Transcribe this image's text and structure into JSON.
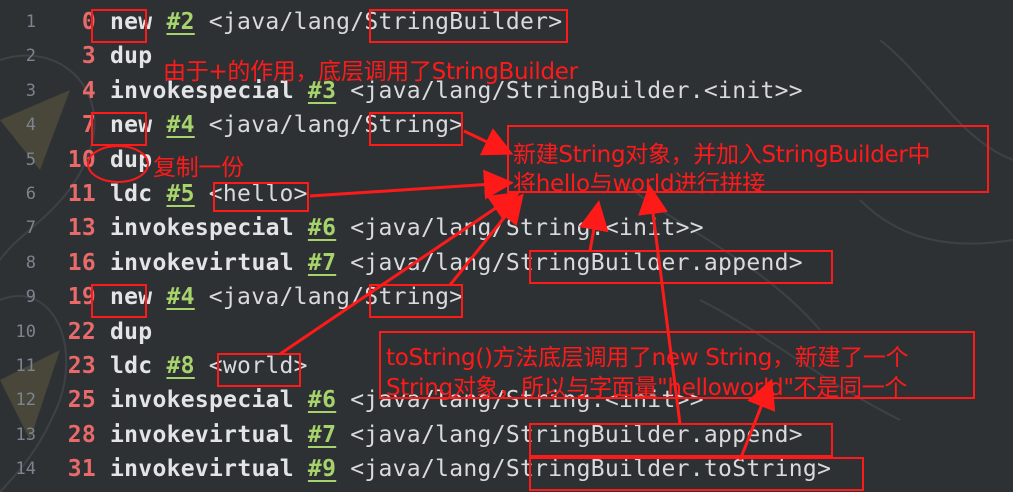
{
  "lines": [
    {
      "num": "1",
      "offset": "0",
      "op": "new",
      "ref": "#2",
      "arg": "<java/lang/StringBuilder>"
    },
    {
      "num": "2",
      "offset": "3",
      "op": "dup",
      "ref": "",
      "arg": ""
    },
    {
      "num": "3",
      "offset": "4",
      "op": "invokespecial",
      "ref": "#3",
      "arg": "<java/lang/StringBuilder.<init>>"
    },
    {
      "num": "4",
      "offset": "7",
      "op": "new",
      "ref": "#4",
      "arg": "<java/lang/String>"
    },
    {
      "num": "5",
      "offset": "10",
      "op": "dup",
      "ref": "",
      "arg": ""
    },
    {
      "num": "6",
      "offset": "11",
      "op": "ldc",
      "ref": "#5",
      "arg": "<hello>"
    },
    {
      "num": "7",
      "offset": "13",
      "op": "invokespecial",
      "ref": "#6",
      "arg": "<java/lang/String.<init>>"
    },
    {
      "num": "8",
      "offset": "16",
      "op": "invokevirtual",
      "ref": "#7",
      "arg": "<java/lang/StringBuilder.append>"
    },
    {
      "num": "9",
      "offset": "19",
      "op": "new",
      "ref": "#4",
      "arg": "<java/lang/String>"
    },
    {
      "num": "10",
      "offset": "22",
      "op": "dup",
      "ref": "",
      "arg": ""
    },
    {
      "num": "11",
      "offset": "23",
      "op": "ldc",
      "ref": "#8",
      "arg": "<world>"
    },
    {
      "num": "12",
      "offset": "25",
      "op": "invokespecial",
      "ref": "#6",
      "arg": "<java/lang/String.<init>>"
    },
    {
      "num": "13",
      "offset": "28",
      "op": "invokevirtual",
      "ref": "#7",
      "arg": "<java/lang/StringBuilder.append>"
    },
    {
      "num": "14",
      "offset": "31",
      "op": "invokevirtual",
      "ref": "#9",
      "arg": "<java/lang/StringBuilder.toString>"
    }
  ],
  "annotations": {
    "note_stringbuilder": "由于+的作用，底层调用了StringBuilder",
    "note_copy": "复制一份",
    "note_new_string_1": "新建String对象，并加入StringBuilder中",
    "note_new_string_2": "将hello与world进行拼接",
    "note_tostring_1": "toString()方法底层调用了new String，新建了一个",
    "note_tostring_2": "String对象，所以与字面量\"helloworld\"不是同一个"
  },
  "colors": {
    "background": "#2e3134",
    "annotation": "#ff1a1a",
    "offset": "#e96a6a",
    "reference": "#a6d36b",
    "opcode": "#e2e4e6",
    "line_number": "#7d8490"
  }
}
